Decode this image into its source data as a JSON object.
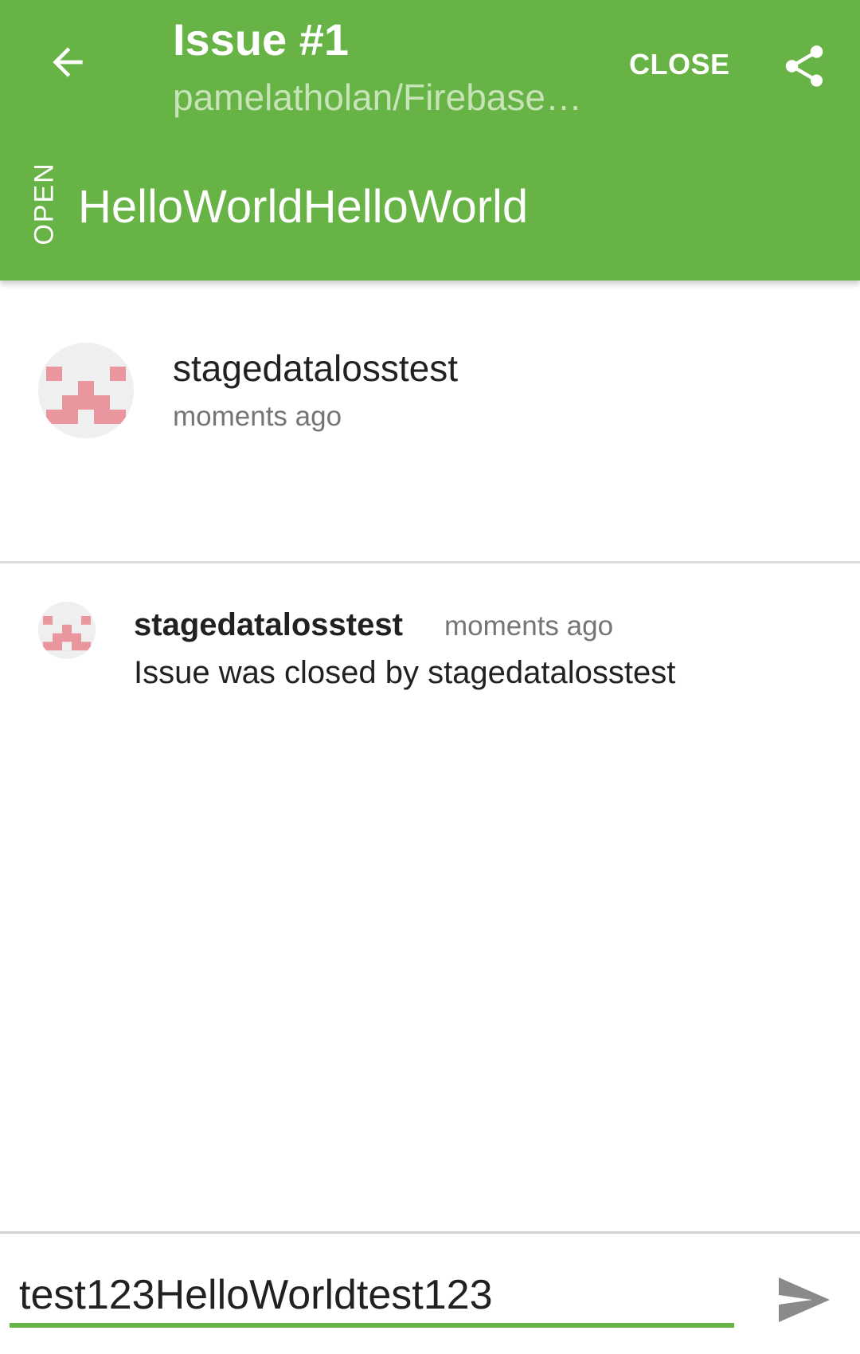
{
  "header": {
    "title": "Issue #1",
    "subtitle": "pamelatholan/Firebase…",
    "close_label": "CLOSE",
    "state_label": "OPEN",
    "issue_title": "HelloWorldHelloWorld",
    "back_icon": "arrow-left-icon",
    "share_icon": "share-icon",
    "background_color": "#67b346"
  },
  "issue": {
    "author": "stagedatalosstest",
    "time": "moments ago"
  },
  "events": [
    {
      "user": "stagedatalosstest",
      "time": "moments ago",
      "text": "Issue was closed by stagedatalosstest"
    }
  ],
  "composer": {
    "value": "test123HelloWorldtest123",
    "send_icon": "send-icon",
    "accent_color": "#67b346"
  }
}
